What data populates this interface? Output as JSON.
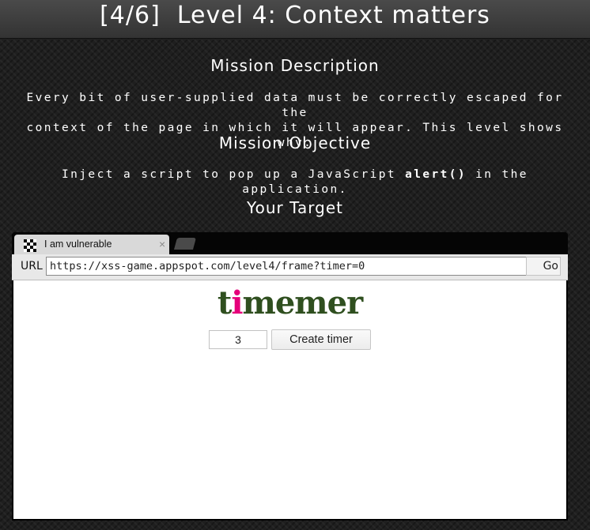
{
  "header": {
    "title": "[4/6]  Level 4: Context matters"
  },
  "mission": {
    "description_heading": "Mission Description",
    "description_line1": "Every bit of user-supplied data must be correctly escaped for the",
    "description_line2": "context of the page in which it will appear. This level shows why.",
    "objective_heading": "Mission Objective",
    "objective_before": "Inject a script to pop up a JavaScript ",
    "objective_code": "alert()",
    "objective_after": " in the application.",
    "target_heading": "Your Target"
  },
  "browser": {
    "tab": {
      "label": "I am vulnerable",
      "close_glyph": "×",
      "favicon": "checker-favicon-icon"
    },
    "toolbar": {
      "url_label": "URL",
      "url_value": "https://xss-game.appspot.com/level4/frame?timer=0",
      "go_label": "Go"
    },
    "app": {
      "logo_pre": "t",
      "logo_accent": "i",
      "logo_post": "memer",
      "timer_value": "3",
      "create_button_label": "Create timer"
    }
  },
  "colors": {
    "logo_green": "#2f4f1f",
    "logo_pink": "#e5007a",
    "page_background": "#1f1f1f"
  }
}
